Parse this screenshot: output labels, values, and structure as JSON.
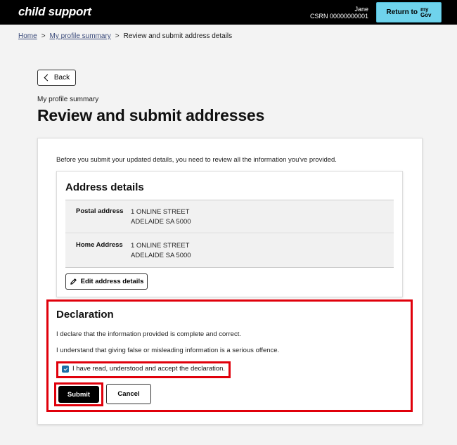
{
  "header": {
    "logo": "child support",
    "user_name": "Jane",
    "csrn": "CSRN 00000000001",
    "return_label": "Return to",
    "mygov_line1": "my",
    "mygov_line2": "Gov"
  },
  "breadcrumb": {
    "home": "Home",
    "profile": "My profile summary",
    "current": "Review and submit address details",
    "separator": ">"
  },
  "back_label": "Back",
  "eyebrow": "My profile summary",
  "page_title": "Review and submit addresses",
  "intro": "Before you submit your updated details, you need to review all the information you've provided.",
  "address_details": {
    "title": "Address details",
    "rows": [
      {
        "label": "Postal address",
        "line1": "1 ONLINE STREET",
        "line2": "ADELAIDE SA 5000"
      },
      {
        "label": "Home Address",
        "line1": "1 ONLINE STREET",
        "line2": "ADELAIDE SA 5000"
      }
    ],
    "edit_label": "Edit address details"
  },
  "declaration": {
    "title": "Declaration",
    "p1": "I declare that the information provided is complete and correct.",
    "p2": "I understand that giving false or misleading information is a serious offence.",
    "checkbox_label": "I have read, understood and accept the declaration.",
    "checked": true
  },
  "actions": {
    "submit": "Submit",
    "cancel": "Cancel"
  },
  "colors": {
    "header_bg": "#000000",
    "return_btn": "#6fd3ec",
    "highlight": "#e0000b",
    "checkbox": "#1b6fa8"
  }
}
